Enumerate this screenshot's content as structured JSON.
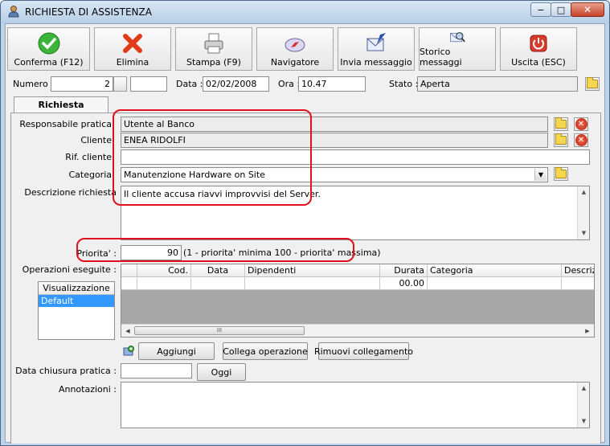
{
  "window": {
    "title": "RICHIESTA DI ASSISTENZA",
    "minimize": "−",
    "maximize": "□",
    "close": "✕"
  },
  "toolbar": {
    "buttons": [
      {
        "label": "Conferma (F12)",
        "icon": "check-icon"
      },
      {
        "label": "Elimina",
        "icon": "delete-x-icon"
      },
      {
        "label": "Stampa (F9)",
        "icon": "printer-icon"
      },
      {
        "label": "Navigatore",
        "icon": "compass-icon"
      },
      {
        "label": "Invia messaggio",
        "icon": "send-message-icon"
      },
      {
        "label": "Storico messaggi",
        "icon": "message-history-icon"
      },
      {
        "label": "Uscita (ESC)",
        "icon": "power-icon"
      }
    ]
  },
  "header": {
    "numero_label": "Numero :",
    "numero_value": "2",
    "numero_suffix": "",
    "data_label": "Data :",
    "data_value": "02/02/2008",
    "ora_label": "Ora :",
    "ora_value": "10.47",
    "stato_label": "Stato :",
    "stato_value": "Aperta"
  },
  "tab": {
    "label": "Richiesta"
  },
  "form": {
    "responsabile_label": "Responsabile pratica",
    "responsabile_value": "Utente al Banco",
    "cliente_label": "Cliente",
    "cliente_value": "ENEA RIDOLFI",
    "rif_label": "Rif. cliente",
    "rif_value": "",
    "categoria_label": "Categoria",
    "categoria_value": "Manutenzione Hardware on Site",
    "descrizione_label": "Descrizione richiesta",
    "descrizione_value": "Il cliente accusa riavvi improvvisi del Server.",
    "priorita_label": "Priorita' :",
    "priorita_value": "90",
    "priorita_hint": "(1 - priorita' minima  100 - priorita' massima)",
    "operazioni_label": "Operazioni eseguite :",
    "visualizzazione_label": "Visualizzazione",
    "visualizzazione_items": [
      "Default"
    ],
    "data_chiusura_label": "Data chiusura pratica :",
    "data_chiusura_value": "",
    "annotazioni_label": "Annotazioni :",
    "annotazioni_value": ""
  },
  "grid": {
    "columns": [
      "Cod.",
      "Data",
      "Dipendenti",
      "Durata",
      "Categoria",
      "Descriz"
    ],
    "rows": [
      [
        "",
        "",
        "",
        "00.00",
        "",
        ""
      ]
    ],
    "hscroll_grip": "III"
  },
  "buttons": {
    "aggiungi": "Aggiungi",
    "collega": "Collega operazione",
    "rimuovi": "Rimuovi collegamento",
    "oggi": "Oggi"
  },
  "colors": {
    "accent_red": "#e0101c",
    "selection": "#3399ff",
    "title_bar": "#c3d7ec"
  }
}
